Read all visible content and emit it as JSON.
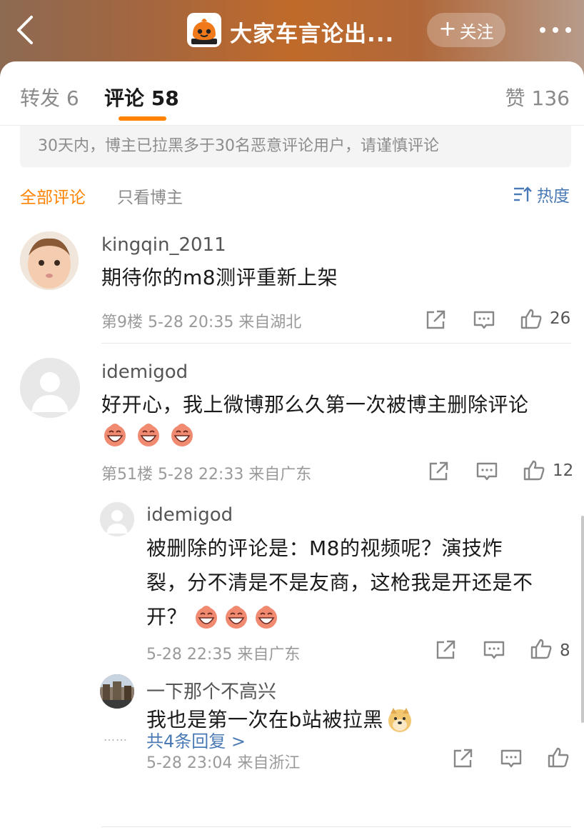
{
  "header": {
    "account_name": "大家车言论出...",
    "follow_label": "关注",
    "colors": {
      "gradient_mid": "#c06a2a",
      "accent": "#ff8200"
    }
  },
  "tabs": {
    "repost": "转发 6",
    "comments": "评论 58",
    "likes": "赞 136"
  },
  "notice": "30天内，博主已拉黑多于30名恶意评论用户，请谨慎评论",
  "filters": {
    "all": "全部评论",
    "blogger_only": "只看博主",
    "sort": "热度"
  },
  "comments": [
    {
      "user": "kingqin_2011",
      "text": "期待你的m8测评重新上架",
      "meta": "第9楼  5-28 20:35  来自湖北",
      "likes": "26"
    },
    {
      "user": "idemigod",
      "text": "好开心，我上微博那么久第一次被博主删除评论",
      "meta": "第51楼  5-28 22:33  来自广东",
      "likes": "12",
      "emoji_count": 3
    }
  ],
  "replies": [
    {
      "user": "idemigod",
      "text_lines": [
        "被删除的评论是：M8的视频呢？演技炸",
        "裂，分不清是不是友商，这枪我是开还是不",
        "开？"
      ],
      "meta": "5-28 22:35  来自广东",
      "likes": "8"
    },
    {
      "user": "一下那个不高兴",
      "text": "我也是第一次在b站被拉黑",
      "meta": "5-28 23:04  来自浙江",
      "likes": ""
    }
  ],
  "more_replies": "共4条回复 >",
  "more_dots": "……"
}
